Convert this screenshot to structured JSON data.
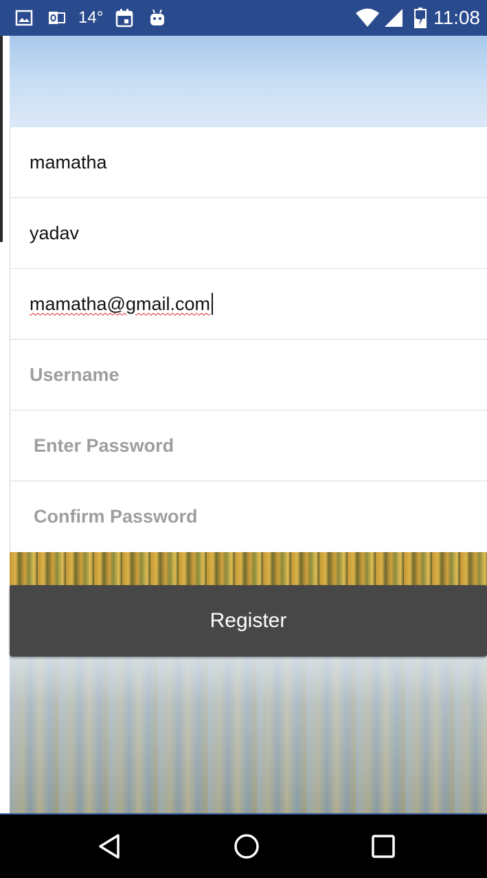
{
  "status_bar": {
    "temperature": "14°",
    "time": "11:08",
    "left_icons": [
      "gallery-icon",
      "outlook-icon",
      "calendar-icon",
      "android-icon"
    ],
    "right_icons": [
      "wifi-icon",
      "cell-signal-icon",
      "battery-charging-icon"
    ]
  },
  "form": {
    "first_name_value": "mamatha",
    "last_name_value": "yadav",
    "email_value": "mamatha@gmail.com",
    "username_placeholder": "Username",
    "password_placeholder": "Enter Password",
    "confirm_password_placeholder": "Confirm Password"
  },
  "actions": {
    "register_label": "Register"
  },
  "nav_bar": {
    "icons": [
      "back-icon",
      "home-icon",
      "recents-icon"
    ]
  },
  "colors": {
    "status_bar": "#2a4a8e",
    "button": "#474747",
    "placeholder": "#9e9e9e"
  }
}
